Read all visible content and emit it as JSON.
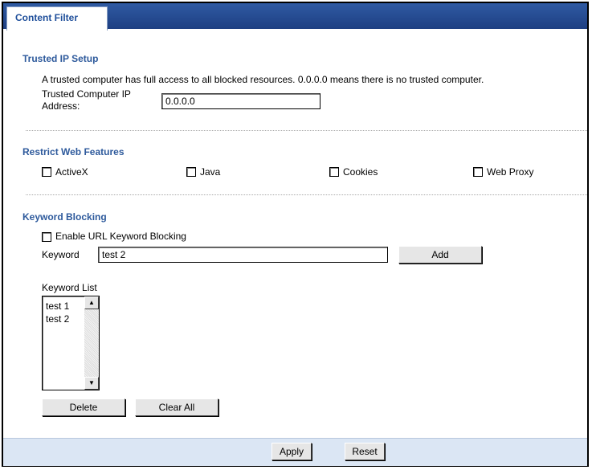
{
  "tab": {
    "label": "Content Filter"
  },
  "trusted": {
    "title": "Trusted IP Setup",
    "description": "A trusted computer has full access to all blocked resources. 0.0.0.0 means there is no trusted computer.",
    "ip_label_line1": "Trusted Computer IP",
    "ip_label_line2": "Address:",
    "ip_value": "0.0.0.0"
  },
  "restrict": {
    "title": "Restrict Web Features",
    "options": [
      {
        "label": "ActiveX",
        "checked": false
      },
      {
        "label": "Java",
        "checked": false
      },
      {
        "label": "Cookies",
        "checked": false
      },
      {
        "label": "Web Proxy",
        "checked": false
      }
    ]
  },
  "keyword": {
    "title": "Keyword Blocking",
    "enable_label": "Enable URL Keyword Blocking",
    "enable_checked": false,
    "field_label": "Keyword",
    "field_value": "test 2",
    "add_label": "Add",
    "list_label": "Keyword List",
    "list_items": [
      "test 1",
      "test 2"
    ],
    "delete_label": "Delete",
    "clear_label": "Clear All"
  },
  "footer": {
    "apply_label": "Apply",
    "reset_label": "Reset"
  },
  "icons": {
    "scroll_up": "scroll-up-arrow-icon",
    "scroll_down": "scroll-down-arrow-icon"
  },
  "colors": {
    "tab_bar": "#1e3f82",
    "section_title": "#2e5a9c",
    "footer_bg": "#dbe6f4"
  }
}
